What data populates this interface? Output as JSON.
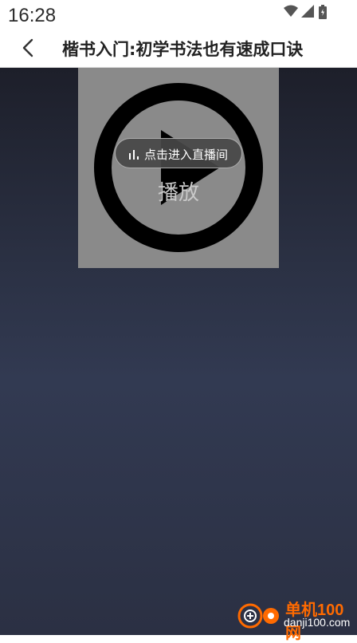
{
  "status_bar": {
    "time": "16:28"
  },
  "header": {
    "title": "楷书入门:初学书法也有速成口诀"
  },
  "video": {
    "play_label": "播放",
    "live_button_label": "点击进入直播间"
  },
  "watermark": {
    "brand": "单机100网",
    "domain": "danji100.com"
  },
  "icons": {
    "back": "chevron-left-icon",
    "wifi": "wifi-icon",
    "signal": "cellular-signal-icon",
    "battery": "battery-icon",
    "play": "play-circle-icon",
    "live": "bar-chart-icon"
  },
  "colors": {
    "content_bg_top": "#1d1f2a",
    "content_bg_mid": "#323a52",
    "poster_bg": "#8a8a8a",
    "watermark_brand": "#ff6a00"
  }
}
